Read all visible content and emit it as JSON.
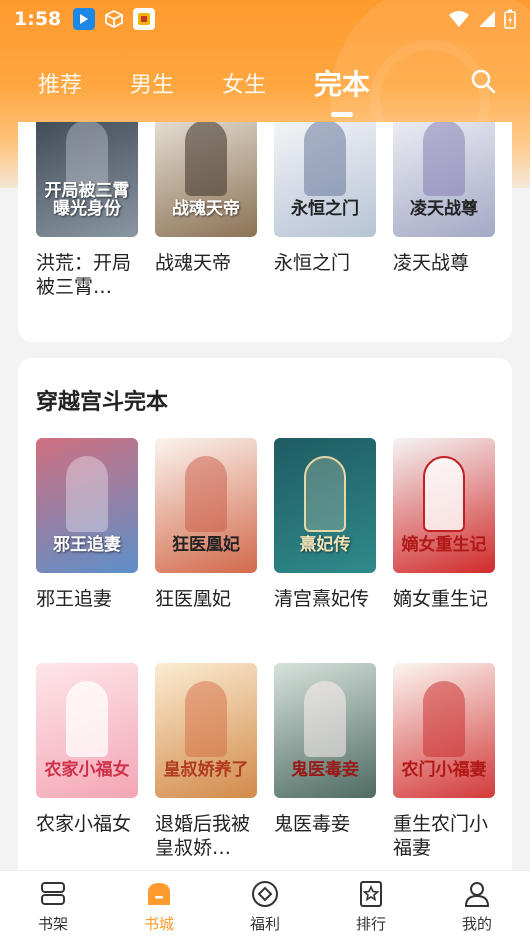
{
  "status_bar": {
    "time": "1:58"
  },
  "tabs": [
    {
      "label": "推荐"
    },
    {
      "label": "男生"
    },
    {
      "label": "女生"
    },
    {
      "label": "完本",
      "active": true
    }
  ],
  "section1": {
    "books": [
      {
        "title": "洪荒：开局被三霄…",
        "cover_text": "开局被三霄曝光身份",
        "colors": [
          "#2f3640",
          "#6b7a86"
        ]
      },
      {
        "title": "战魂天帝",
        "cover_text": "战魂天帝",
        "colors": [
          "#e9e5dc",
          "#8c7256"
        ]
      },
      {
        "title": "永恒之门",
        "cover_text": "永恒之门",
        "colors": [
          "#f4f4f4",
          "#b7c3d6"
        ]
      },
      {
        "title": "凌天战尊",
        "cover_text": "凌天战尊",
        "colors": [
          "#eef0f6",
          "#a4a9c6"
        ]
      }
    ]
  },
  "section2": {
    "title": "穿越宫斗完本",
    "books": [
      {
        "title": "邪王追妻",
        "cover_text": "邪王追妻",
        "colors": [
          "#c25a6a",
          "#5d8fc9"
        ]
      },
      {
        "title": "狂医凰妃",
        "cover_text": "狂医凰妃",
        "colors": [
          "#f6efe8",
          "#d2694a"
        ]
      },
      {
        "title": "清宫熹妃传",
        "cover_text": "熹妃传",
        "colors": [
          "#1f5b63",
          "#2f8a8a"
        ]
      },
      {
        "title": "嫡女重生记",
        "cover_text": "嫡女重生记",
        "colors": [
          "#f2f2f2",
          "#d12a2a"
        ]
      },
      {
        "title": "农家小福女",
        "cover_text": "农家小福女",
        "colors": [
          "#fde0e4",
          "#f4a6b5"
        ]
      },
      {
        "title": "退婚后我被皇叔娇…",
        "cover_text": "皇叔娇养了",
        "colors": [
          "#f8e6c8",
          "#d28a4a"
        ]
      },
      {
        "title": "鬼医毒妾",
        "cover_text": "鬼医毒妾",
        "colors": [
          "#cfd9d4",
          "#4d6b62"
        ]
      },
      {
        "title": "重生农门小福妻",
        "cover_text": "农门小福妻",
        "colors": [
          "#faf3ee",
          "#d23a3a"
        ]
      }
    ]
  },
  "bottom_nav": [
    {
      "label": "书架",
      "icon": "bookshelf-icon"
    },
    {
      "label": "书城",
      "icon": "bookstore-icon",
      "active": true
    },
    {
      "label": "福利",
      "icon": "gift-icon"
    },
    {
      "label": "排行",
      "icon": "ranking-icon"
    },
    {
      "label": "我的",
      "icon": "profile-icon"
    }
  ],
  "colors": {
    "accent": "#ff9a2e",
    "header": "#ffa63f"
  }
}
